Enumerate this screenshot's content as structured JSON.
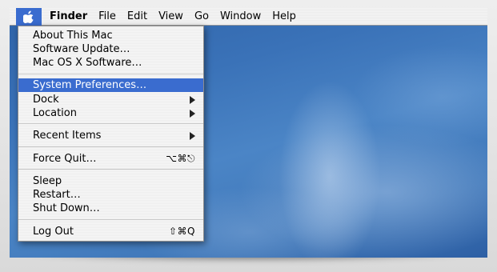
{
  "menubar": {
    "items": [
      "Finder",
      "File",
      "Edit",
      "View",
      "Go",
      "Window",
      "Help"
    ]
  },
  "apple_menu": {
    "items": [
      {
        "label": "About This Mac"
      },
      {
        "label": "Software Update…"
      },
      {
        "label": "Mac OS X Software…"
      },
      {
        "label": "System Preferences…",
        "selected": true
      },
      {
        "label": "Dock",
        "submenu": true
      },
      {
        "label": "Location",
        "submenu": true
      },
      {
        "label": "Recent Items",
        "submenu": true
      },
      {
        "label": "Force Quit…",
        "shortcut": "⌥⌘⎋"
      },
      {
        "label": "Sleep"
      },
      {
        "label": "Restart…"
      },
      {
        "label": "Shut Down…"
      },
      {
        "label": "Log Out",
        "shortcut": "⇧⌘Q"
      }
    ]
  },
  "colors": {
    "highlight": "#3a6ccf",
    "menu_bg": "#f4f4f4",
    "desktop": "#3a72b8"
  }
}
